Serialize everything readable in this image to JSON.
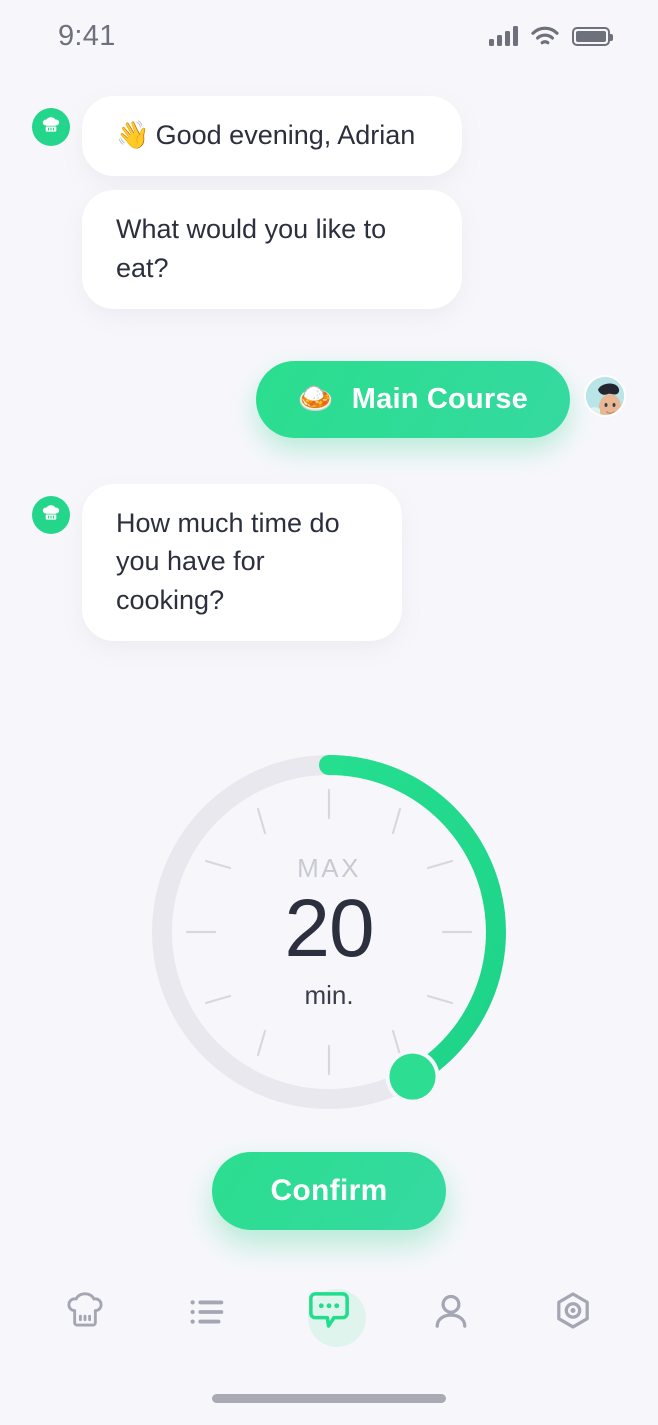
{
  "status_bar": {
    "time": "9:41",
    "signal_icon": "signal-bars-icon",
    "wifi_icon": "wifi-icon",
    "battery_icon": "battery-icon"
  },
  "chat": {
    "bot_avatar_icon": "chef-hat-avatar-icon",
    "messages": [
      {
        "sender": "bot",
        "emoji": "👋",
        "text": "Good evening, Adrian"
      },
      {
        "sender": "bot",
        "emoji": "",
        "text": "What would you like to eat?"
      },
      {
        "sender": "user",
        "emoji": "🍛",
        "text": "Main Course"
      },
      {
        "sender": "bot",
        "emoji": "",
        "text": "How much time do you have for cooking?"
      }
    ],
    "user_avatar_name": "user-avatar-photo"
  },
  "dial": {
    "label": "MAX",
    "value": "20",
    "unit": "min.",
    "percent": 42,
    "angle_degrees": 150,
    "track_color": "#E9E8EF",
    "arc_color": "#21D98A",
    "tick_count": 12
  },
  "confirm": {
    "label": "Confirm"
  },
  "bottom_nav": {
    "items": [
      {
        "name": "nav-recipes",
        "icon": "chef-hat-icon",
        "active": false
      },
      {
        "name": "nav-list",
        "icon": "list-icon",
        "active": false
      },
      {
        "name": "nav-chat",
        "icon": "chat-bubble-icon",
        "active": true
      },
      {
        "name": "nav-profile",
        "icon": "person-icon",
        "active": false
      },
      {
        "name": "nav-settings",
        "icon": "hexagon-settings-icon",
        "active": false
      }
    ],
    "active_color": "#22DE8C",
    "inactive_color": "#A4A6B3"
  }
}
